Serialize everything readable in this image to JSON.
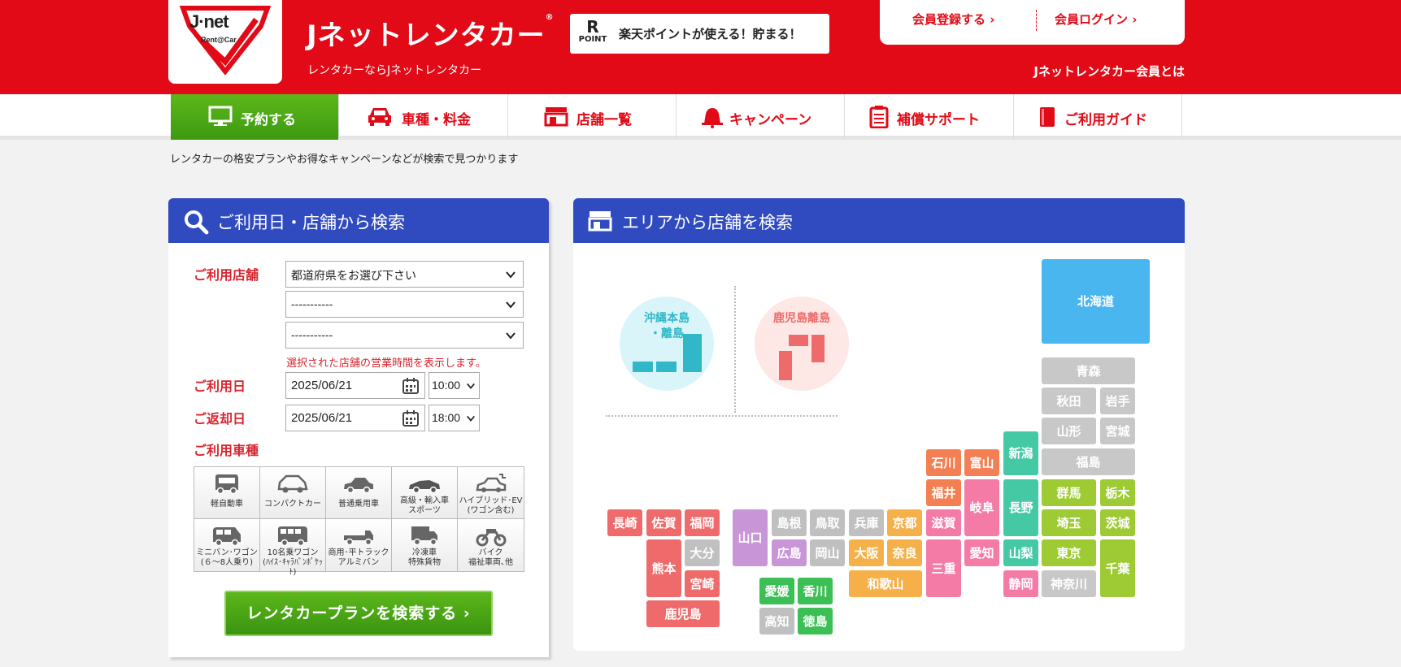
{
  "header": {
    "logo_line1": "J·net",
    "logo_line2": "Rent@Car",
    "brand_name": "Jネットレンタカー",
    "brand_mark": "®",
    "brand_sub": "レンタカーならJネットレンタカー",
    "rakuten_logo_r": "R",
    "rakuten_logo_point": "POINT",
    "rakuten_text": "楽天ポイントが使える！貯まる！",
    "register_label": "会員登録する",
    "login_label": "会員ログイン",
    "member_about": "Jネットレンタカー会員とは",
    "brand_color": "#e10a16"
  },
  "nav": {
    "items": [
      {
        "label": "予約する",
        "icon": "monitor-icon"
      },
      {
        "label": "車種・料金",
        "icon": "car-icon"
      },
      {
        "label": "店舗一覧",
        "icon": "store-icon"
      },
      {
        "label": "キャンペーン",
        "icon": "bell-icon"
      },
      {
        "label": "補償サポート",
        "icon": "clipboard-icon"
      },
      {
        "label": "ご利用ガイド",
        "icon": "book-icon"
      }
    ]
  },
  "tagline": "レンタカーの格安プランやお得なキャンペーンなどが検索で見つかります",
  "search": {
    "title": "ご利用日・店舗から検索",
    "store_label": "ご利用店舗",
    "prefecture_value": "都道府県をお選び下さい",
    "city_value": "-----------",
    "shop_value": "-----------",
    "hours_hint": "選択された店舗の営業時間を表示します。",
    "pickup_label": "ご利用日",
    "pickup_date": "2025/06/21",
    "pickup_time": "10:00",
    "return_label": "ご返却日",
    "return_date": "2025/06/21",
    "return_time": "18:00",
    "car_type_label": "ご利用車種",
    "car_types": [
      {
        "label": "軽自動車"
      },
      {
        "label": "コンパクトカー"
      },
      {
        "label": "普通乗用車"
      },
      {
        "label": "高級・輸入車\nスポーツ"
      },
      {
        "label": "ハイブリッド･EV\n(ワゴン含む)"
      },
      {
        "label": "ミニバン･ワゴン\n(６〜8人乗り)"
      },
      {
        "label": "10名乗ワゴン\n(ﾊｲｽ･ｷｬﾗﾊﾞﾝﾎﾟｹｯﾄ)"
      },
      {
        "label": "商用･平トラック\nアルミバン"
      },
      {
        "label": "冷凍車\n特殊貨物"
      },
      {
        "label": "バイク\n福祉車両､他"
      }
    ],
    "submit_label": "レンタカープランを検索する",
    "accent_color": "#2f4bbf"
  },
  "area": {
    "title": "エリアから店舗を検索",
    "okinawa_label": "沖縄本島\n・離島",
    "kagoshima_islands_label": "鹿児島離島",
    "prefectures": {
      "hokkaido": "北海道",
      "aomori": "青森",
      "akita": "秋田",
      "iwate": "岩手",
      "yamagata": "山形",
      "miyagi": "宮城",
      "fukushima": "福島",
      "niigata": "新潟",
      "nagano": "長野",
      "yamanashi": "山梨",
      "shizuoka": "静岡",
      "gunma": "群馬",
      "tochigi": "栃木",
      "saitama": "埼玉",
      "ibaraki": "茨城",
      "tokyo": "東京",
      "chiba": "千葉",
      "kanagawa": "神奈川",
      "ishikawa": "石川",
      "toyama": "富山",
      "fukui": "福井",
      "gifu": "岐阜",
      "shiga": "滋賀",
      "aichi": "愛知",
      "mie": "三重",
      "kyoto": "京都",
      "hyogo": "兵庫",
      "osaka": "大阪",
      "nara": "奈良",
      "wakayama": "和歌山",
      "tottori": "鳥取",
      "shimane": "島根",
      "okayama": "岡山",
      "hiroshima": "広島",
      "yamaguchi": "山口",
      "ehime": "愛媛",
      "kagawa": "香川",
      "kochi": "高知",
      "tokushima": "徳島",
      "nagasaki": "長崎",
      "saga": "佐賀",
      "fukuoka": "福岡",
      "kumamoto": "熊本",
      "oita": "大分",
      "miyazaki": "宮崎",
      "kagoshima": "鹿児島"
    }
  }
}
